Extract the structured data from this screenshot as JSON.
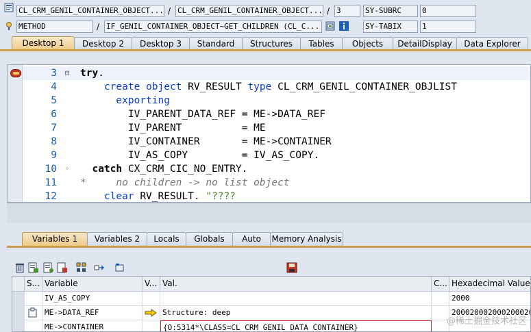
{
  "infobar": {
    "row1": {
      "program": "CL_CRM_GENIL_CONTAINER_OBJECT...",
      "include": "CL_CRM_GENIL_CONTAINER_OBJECT...",
      "line": "3",
      "sysfield": "SY-SUBRC",
      "sysvalue": "0",
      "separator": "/"
    },
    "row2": {
      "event_type": "METHOD",
      "event": "IF_GENIL_CONTAINER_OBJECT~GET_CHILDREN (CL_C...",
      "sysfield": "SY-TABIX",
      "sysvalue": "1",
      "separator": "/"
    }
  },
  "tabs": [
    {
      "label": "Desktop 1",
      "active": true
    },
    {
      "label": "Desktop 2",
      "active": false
    },
    {
      "label": "Desktop 3",
      "active": false
    },
    {
      "label": "Standard",
      "active": false
    },
    {
      "label": "Structures",
      "active": false
    },
    {
      "label": "Tables",
      "active": false
    },
    {
      "label": "Objects",
      "active": false
    },
    {
      "label": "DetailDisplay",
      "active": false
    },
    {
      "label": "Data Explorer",
      "active": false
    }
  ],
  "code": {
    "lines": [
      {
        "num": "3",
        "mark": "⊟",
        "parts": [
          {
            "t": "try",
            "c": "kwb"
          },
          {
            "t": ".",
            "c": ""
          }
        ]
      },
      {
        "num": "4",
        "mark": "",
        "parts": [
          {
            "t": "    create object ",
            "c": "kw"
          },
          {
            "t": "RV_RESULT ",
            "c": ""
          },
          {
            "t": "type ",
            "c": "kw"
          },
          {
            "t": "CL_CRM_GENIL_CONTAINER_OBJLIST",
            "c": ""
          }
        ]
      },
      {
        "num": "5",
        "mark": "",
        "parts": [
          {
            "t": "      exporting",
            "c": "kw"
          }
        ]
      },
      {
        "num": "6",
        "mark": "",
        "parts": [
          {
            "t": "        IV_PARENT_DATA_REF = ME->DATA_REF",
            "c": ""
          }
        ]
      },
      {
        "num": "7",
        "mark": "",
        "parts": [
          {
            "t": "        IV_PARENT          = ME",
            "c": ""
          }
        ]
      },
      {
        "num": "8",
        "mark": "",
        "parts": [
          {
            "t": "        IV_CONTAINER       = ME->CONTAINER",
            "c": ""
          }
        ]
      },
      {
        "num": "9",
        "mark": "",
        "parts": [
          {
            "t": "        IV_AS_COPY         = IV_AS_COPY.",
            "c": ""
          }
        ]
      },
      {
        "num": "10",
        "mark": "◦",
        "parts": [
          {
            "t": "  catch ",
            "c": "kwb"
          },
          {
            "t": "CX_CRM_CIC_NO_ENTRY.",
            "c": ""
          }
        ]
      },
      {
        "num": "11",
        "mark": "",
        "parts": [
          {
            "t": "*     no children -> no list object",
            "c": "cm"
          }
        ]
      },
      {
        "num": "12",
        "mark": "",
        "parts": [
          {
            "t": "    clear ",
            "c": "kw"
          },
          {
            "t": "RV_RESULT. ",
            "c": ""
          },
          {
            "t": "\"????",
            "c": "st"
          }
        ]
      }
    ]
  },
  "lower_tabs": [
    {
      "label": "Variables 1",
      "active": true
    },
    {
      "label": "Variables 2",
      "active": false
    },
    {
      "label": "Locals",
      "active": false
    },
    {
      "label": "Globals",
      "active": false
    },
    {
      "label": "Auto",
      "active": false
    },
    {
      "label": "Memory Analysis",
      "active": false
    }
  ],
  "grid": {
    "headers": {
      "s": "S...",
      "variable": "Variable",
      "v": "V...",
      "val": "Val.",
      "c": "C...",
      "hex": "Hexadecimal Value"
    },
    "rows": [
      {
        "variable": "IV_AS_COPY",
        "val": "",
        "hex": "2000"
      },
      {
        "variable": "ME->DATA_REF",
        "val": "Structure: deep",
        "hex": "200020002000200020002"
      },
      {
        "variable": "ME->CONTAINER",
        "val": "{O:5314*\\CLASS=CL_CRM_GENIL_DATA_CONTAINER}",
        "hex": ""
      }
    ]
  },
  "watermark": "@稀土掘金技术社区"
}
